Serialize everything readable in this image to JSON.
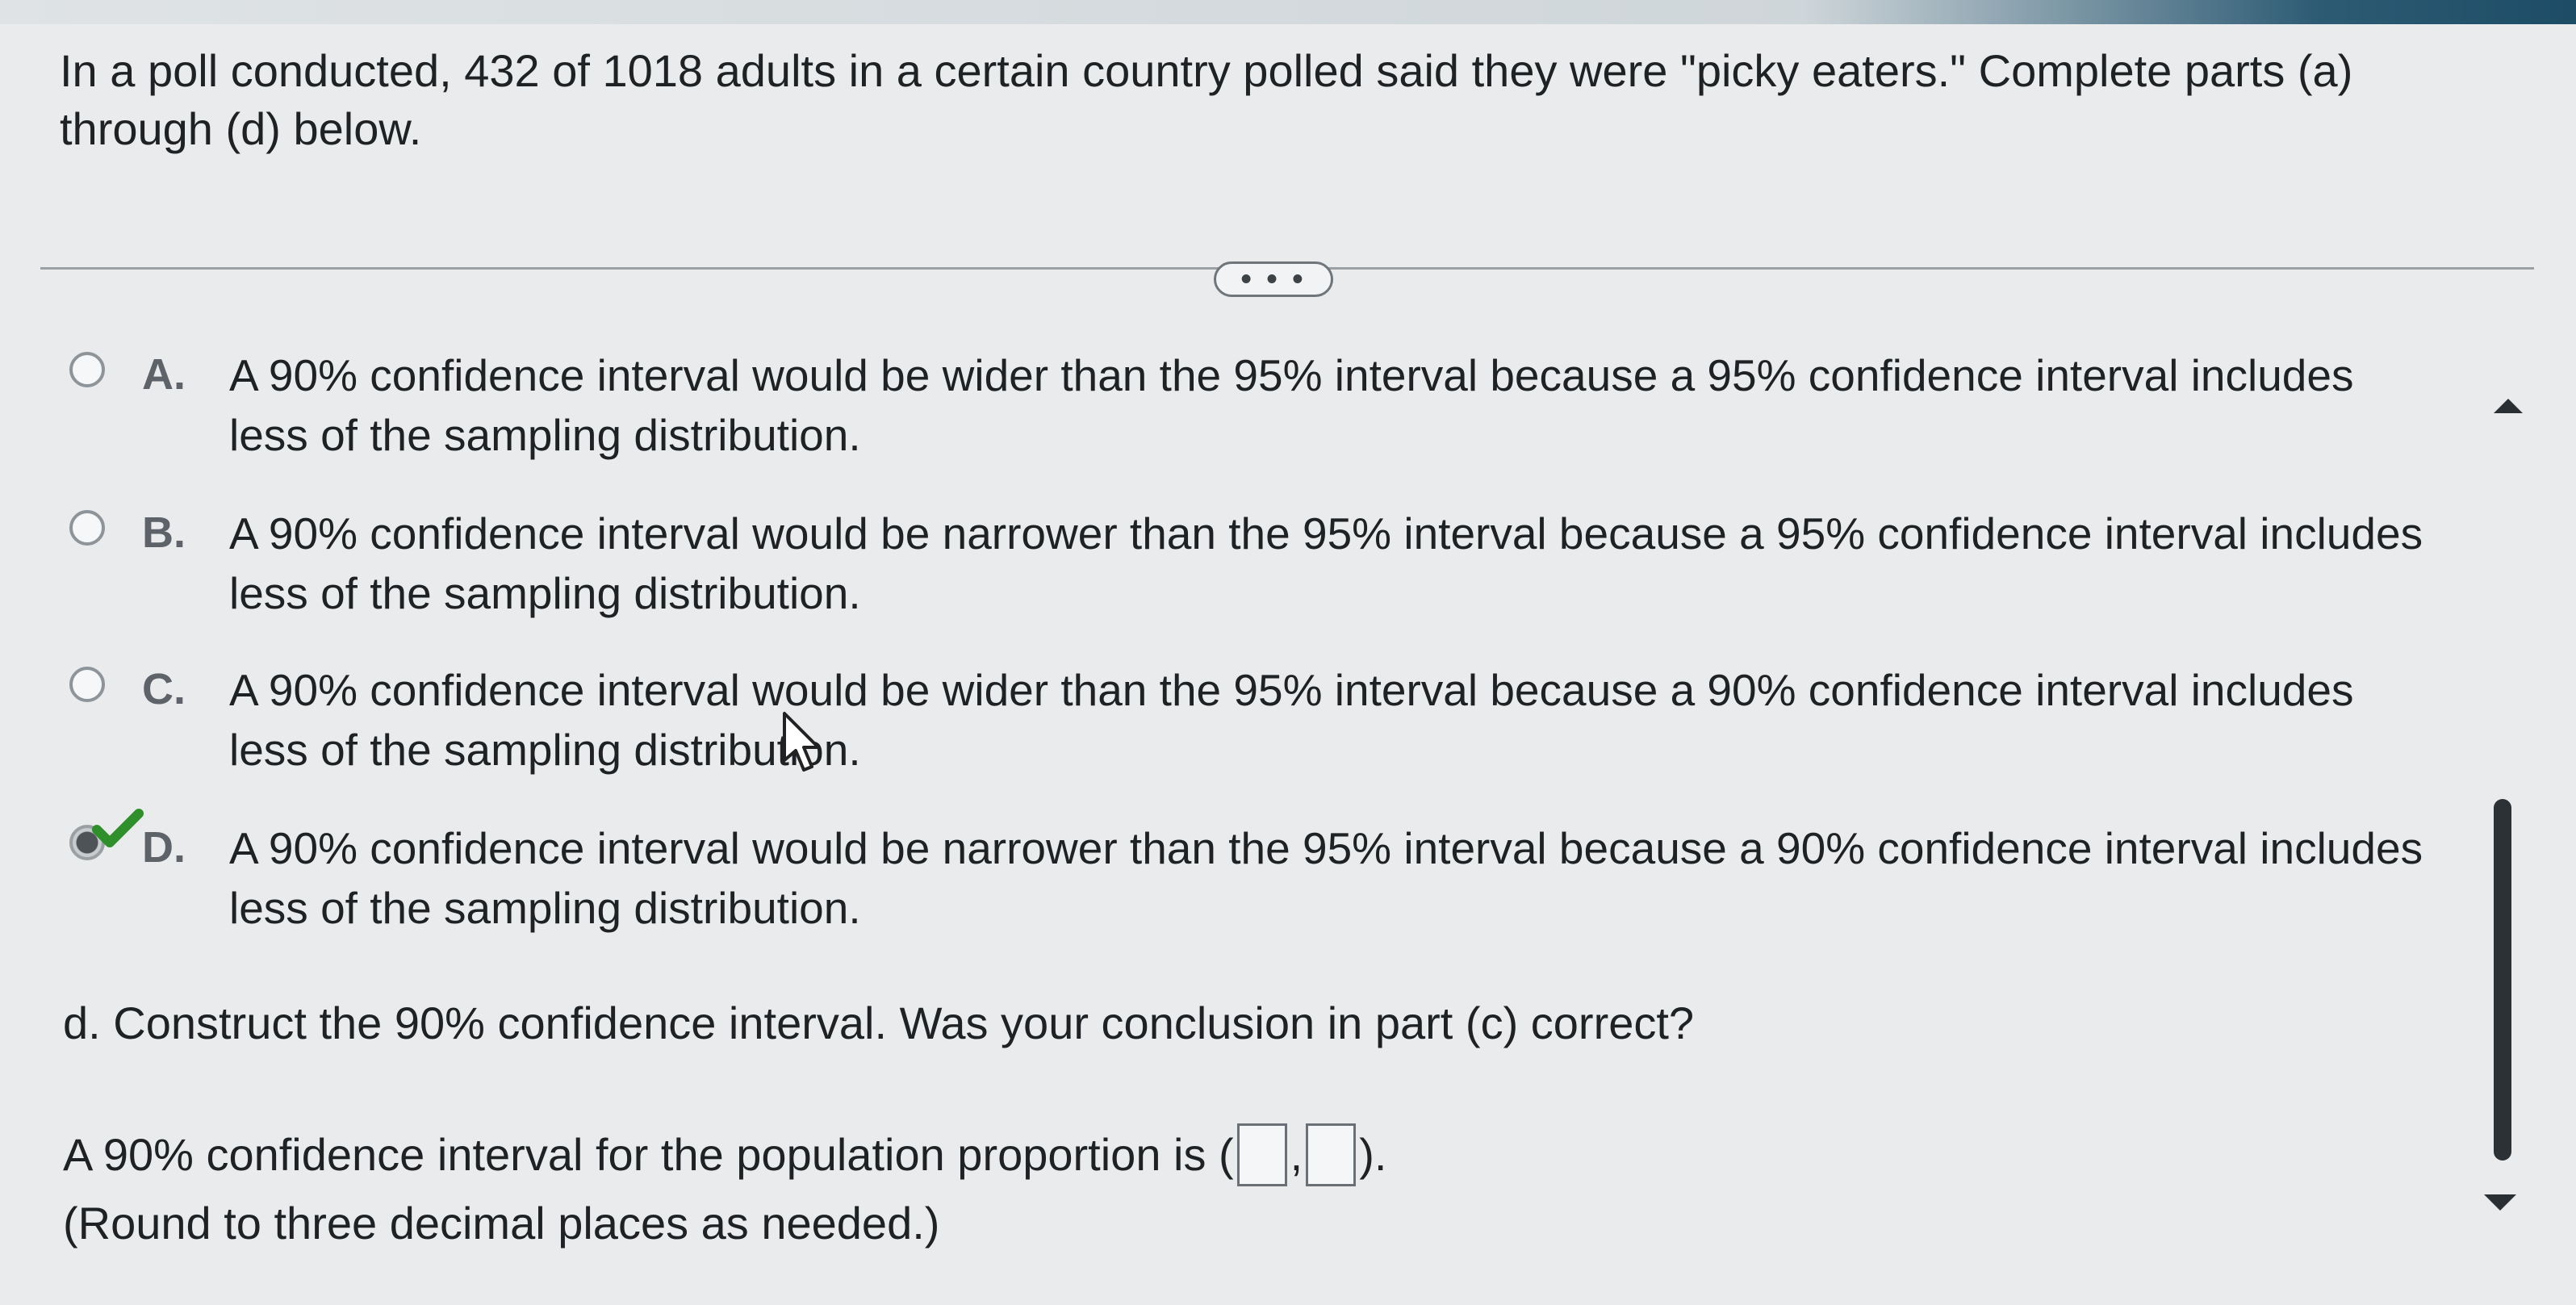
{
  "question": {
    "intro": "In a poll conducted, 432 of 1018 adults in a certain country polled said they were \"picky eaters.\" Complete parts (a) through (d) below."
  },
  "expand_button": {
    "label": "• • •"
  },
  "options": [
    {
      "letter": "A.",
      "text": "A 90% confidence interval would be wider than the 95% interval because a 95% confidence interval includes less of the sampling distribution.",
      "selected": false
    },
    {
      "letter": "B.",
      "text": "A 90% confidence interval would be narrower than the 95% interval because a 95% confidence interval includes less of the sampling distribution.",
      "selected": false
    },
    {
      "letter": "C.",
      "text": "A 90% confidence interval would be wider than the 95% interval because a 90% confidence interval includes less of the sampling distribution.",
      "selected": false
    },
    {
      "letter": "D.",
      "text": "A 90% confidence interval would be narrower than the 95% interval because a 90% confidence interval includes less of the sampling distribution.",
      "selected": true
    }
  ],
  "part_d": {
    "prompt": "d. Construct the 90% confidence interval. Was your conclusion in part (c) correct?",
    "ci_prefix": "A 90% confidence interval for the population proportion is (",
    "ci_separator": ",",
    "ci_suffix": ").",
    "lower_value": "",
    "upper_value": "",
    "note": "(Round to three decimal places as needed.)"
  },
  "icons": {
    "correct": "checkmark-icon",
    "scroll_up": "triangle-up-icon",
    "scroll_down": "triangle-down-icon",
    "pointer": "mouse-cursor-icon"
  },
  "colors": {
    "check_green": "#2f8f2a",
    "accent_bar": "#1d4c66"
  }
}
